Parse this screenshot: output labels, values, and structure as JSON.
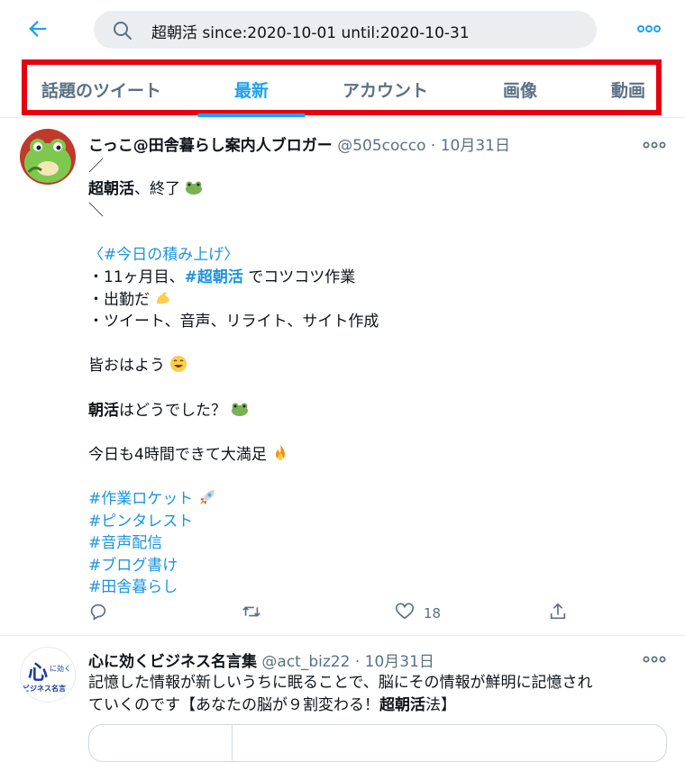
{
  "search": {
    "query": "超朝活 since:2020-10-01 until:2020-10-31"
  },
  "icons": {
    "back": "arrow-left-icon",
    "search": "magnifier-icon",
    "more": "ellipsis-icon",
    "reply": "reply-icon",
    "retweet": "retweet-icon",
    "like": "heart-icon",
    "share": "share-icon"
  },
  "colors": {
    "accent": "#1da1f2",
    "highlight_box": "#e60012",
    "muted": "#5b7083"
  },
  "tabs": [
    {
      "label": "話題のツイート"
    },
    {
      "label": "最新"
    },
    {
      "label": "アカウント"
    },
    {
      "label": "画像"
    },
    {
      "label": "動画"
    }
  ],
  "tweet1": {
    "name": "こっこ@田舎暮らし案内人ブロガー",
    "handle": "@505cocco",
    "dot": "·",
    "date": "10月31日",
    "lines": {
      "l1": "／",
      "l2a": "超朝活",
      "l2b": "、終了",
      "l3": "＼",
      "l5a": "〈",
      "l5b": "#今日の積み上げ",
      "l5c": "〉",
      "l6a": "・11ヶ月目、",
      "l6b": "#超朝活",
      "l6c": " でコツコツ作業",
      "l7": "・出勤だ",
      "l8": "・ツイート、音声、リライト、サイト作成",
      "l10": "皆おはよう",
      "l12a": "朝活",
      "l12b": "はどうでした？",
      "l14": "今日も4時間できて大満足",
      "h1": "#作業ロケット",
      "h2": "#ピンタレスト",
      "h3": "#音声配信",
      "h4": "#ブログ書け",
      "h5": "#田舎暮らし"
    },
    "likes": "18"
  },
  "tweet2": {
    "name": "心に効くビジネス名言集",
    "handle": "@act_biz22",
    "dot": "·",
    "date": "10月31日",
    "line1": "記憶した情報が新しいうちに眠ることで、脳にその情報が鮮明に記憶され",
    "line2a": "ていくのです【あなたの脳が９割変わる！",
    "line2b": "超朝活",
    "line2c": "法】",
    "avatar_text_top": "心",
    "avatar_text_small": "に効く",
    "avatar_text_bottom": "ビジネス名言"
  }
}
